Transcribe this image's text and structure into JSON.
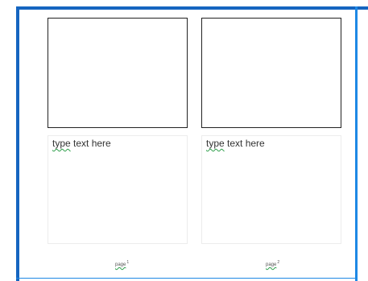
{
  "panels": [
    {
      "text_first": "type",
      "text_rest": " text here",
      "page_word": "page",
      "page_number": "1"
    },
    {
      "text_first": "type",
      "text_rest": " text here",
      "page_word": "page",
      "page_number": "2"
    }
  ],
  "colors": {
    "frame_accent": "#1565c0",
    "spellcheck_underline": "#2e9e4a"
  }
}
